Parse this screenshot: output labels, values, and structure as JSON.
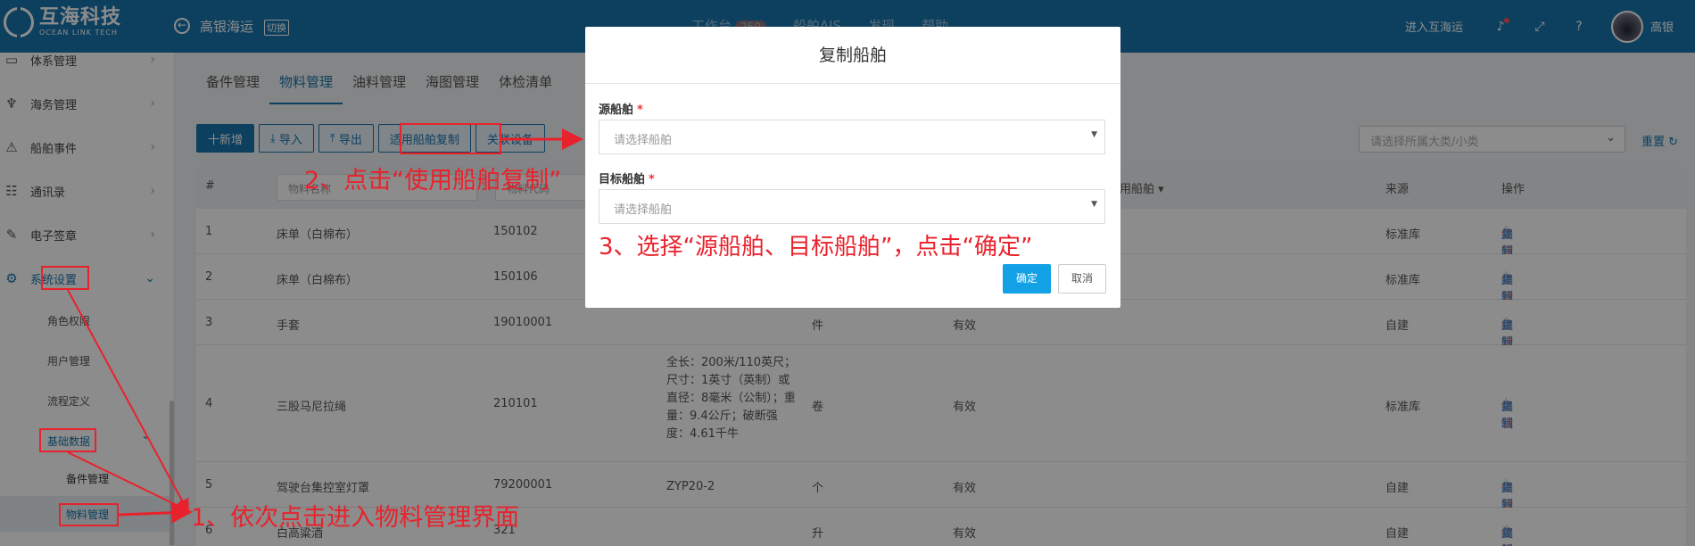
{
  "app": {
    "name_cn": "互海科技",
    "name_en": "OCEAN LINK TECH"
  },
  "header": {
    "company": "高银海运",
    "switch_label": "切换",
    "nav": [
      {
        "label": "工作台",
        "badge": "250"
      },
      {
        "label": "船舶AIS"
      },
      {
        "label": "发现"
      },
      {
        "label": "帮助"
      }
    ],
    "enter_label": "进入互海运",
    "user": "高银"
  },
  "sidebar": {
    "items": [
      {
        "label": "体系管理"
      },
      {
        "label": "海务管理"
      },
      {
        "label": "船舶事件"
      },
      {
        "label": "通讯录"
      },
      {
        "label": "电子签章"
      },
      {
        "label": "系统设置"
      }
    ],
    "sub": [
      "角色权限",
      "用户管理",
      "流程定义",
      "基础数据"
    ],
    "subsub": [
      "备件管理",
      "物料管理"
    ]
  },
  "tabs": [
    "备件管理",
    "物料管理",
    "油料管理",
    "海图管理",
    "体检清单"
  ],
  "toolbar": {
    "add": "十新增",
    "import": "导入",
    "export": "导出",
    "copy": "适用船舶复制",
    "associate": "关联设备"
  },
  "filter": {
    "category_placeholder": "请选择所属大类/小类",
    "reset": "重置"
  },
  "table": {
    "headers": {
      "index": "#",
      "name_ph": "物料名称",
      "code_ph": "物料代码",
      "ship": "适用船舶",
      "source": "来源",
      "ops": "操作"
    },
    "rows": [
      {
        "no": "1",
        "name": "床单（白棉布）",
        "code": "150102",
        "spec": "",
        "unit": "",
        "status": "",
        "source": "标准库"
      },
      {
        "no": "2",
        "name": "床单（白棉布）",
        "code": "150106",
        "spec": "",
        "unit": "",
        "status": "",
        "source": "标准库"
      },
      {
        "no": "3",
        "name": "手套",
        "code": "19010001",
        "spec": "",
        "unit": "件",
        "status": "有效",
        "source": "自建"
      },
      {
        "no": "4",
        "name": "三股马尼拉绳",
        "code": "210101",
        "spec": "全长：200米/110英尺；尺寸：1英寸（英制）或直径：8毫米（公制）；重量：9.4公斤；破断强度：4.61千牛",
        "unit": "卷",
        "status": "有效",
        "source": "标准库"
      },
      {
        "no": "5",
        "name": "驾驶台集控室灯罩",
        "code": "79200001",
        "spec": "ZYP20-2",
        "unit": "个",
        "status": "有效",
        "source": "自建"
      },
      {
        "no": "6",
        "name": "白高粱酒",
        "code": "321",
        "spec": "",
        "unit": "升",
        "status": "有效",
        "source": "自建"
      }
    ],
    "ops": {
      "edit": "编辑",
      "disable": "失效",
      "copy": "复制"
    }
  },
  "modal": {
    "title": "复制船舶",
    "source_label": "源船舶",
    "source_placeholder": "请选择船舶",
    "target_label": "目标船舶",
    "target_placeholder": "请选择船舶",
    "ok": "确定",
    "cancel": "取消"
  },
  "annotations": {
    "step1": "1、依次点击进入物料管理界面",
    "step2": "2、点击“使用船舶复制”",
    "step3": "3、选择“源船舶、目标船舶”，点击“确定”"
  },
  "colors": {
    "primary": "#1976ae",
    "annotation": "#e8222c",
    "confirm": "#13a1e6"
  }
}
